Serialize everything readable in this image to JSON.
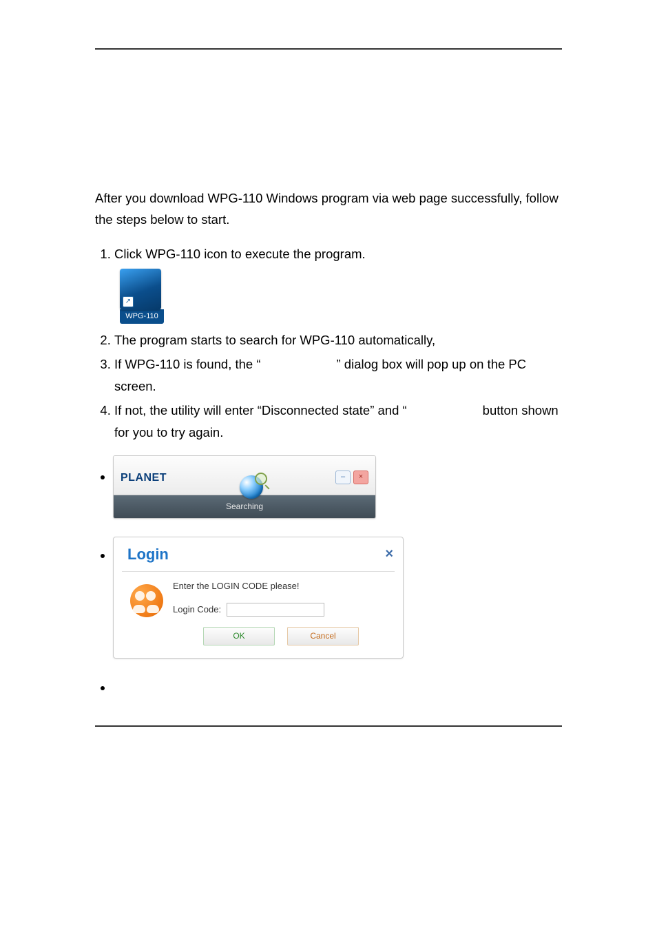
{
  "intro": "After you download WPG-110 Windows program via web page successfully, follow the steps below to start.",
  "steps": {
    "s1": "Click WPG-110 icon to execute the program.",
    "icon_label": "WPG-110",
    "s2": "The program starts to search for WPG-110 automatically,",
    "s3_a": "If WPG-110 is found, the “",
    "s3_b": "” dialog box will pop up on the PC screen.",
    "s4_a": "If not, the utility will enter “Disconnected state” and “",
    "s4_b": "button shown for you to try again."
  },
  "search_panel": {
    "brand": "PLANET",
    "status": "Searching",
    "min_symbol": "–",
    "close_symbol": "×"
  },
  "login_panel": {
    "title": "Login",
    "close_symbol": "×",
    "message": "Enter the LOGIN CODE please!",
    "field_label": "Login Code:",
    "ok_label": "OK",
    "cancel_label": "Cancel"
  }
}
